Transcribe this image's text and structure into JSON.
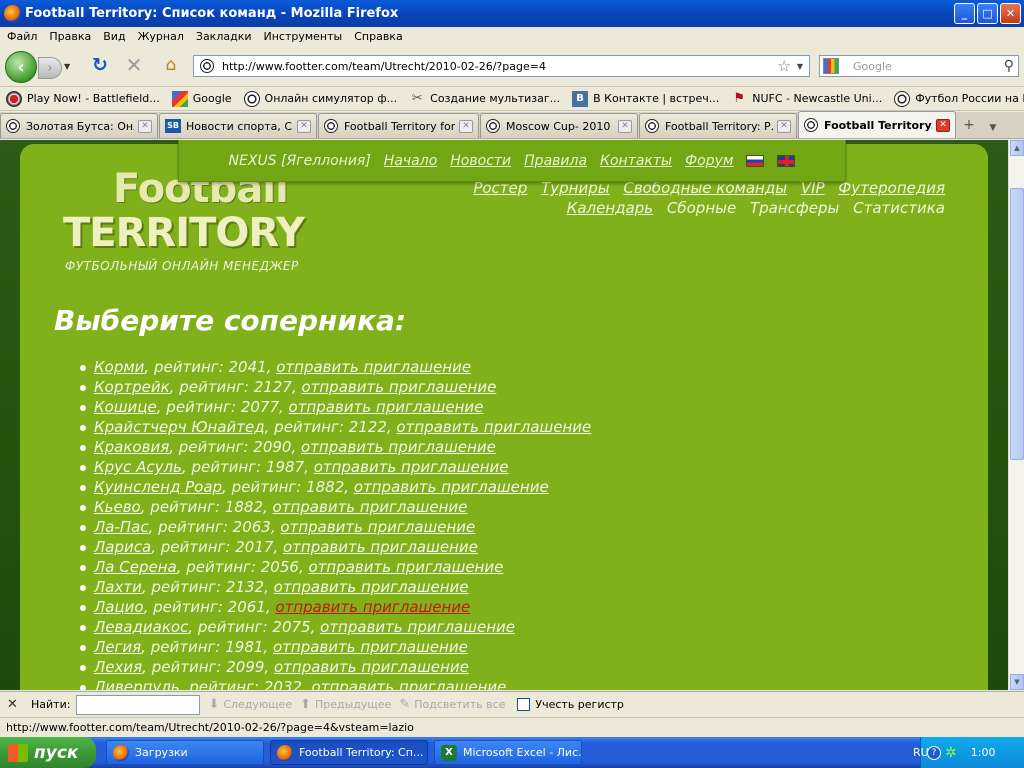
{
  "window": {
    "title": "Football Territory: Список команд - Mozilla Firefox",
    "min": "_",
    "max": "□",
    "close": "✕"
  },
  "menu": [
    "Файл",
    "Правка",
    "Вид",
    "Журнал",
    "Закладки",
    "Инструменты",
    "Справка"
  ],
  "nav": {
    "back_glyph": "‹",
    "forward_glyph": "›",
    "reload_glyph": "↻",
    "stop_glyph": "✕",
    "home_glyph": "⌂",
    "url": "http://www.footter.com/team/Utrecht/2010-02-26/?page=4",
    "search_placeholder": "Google"
  },
  "bookmarks": [
    {
      "label": "Play Now! - Battlefield...",
      "icon": "play-icon"
    },
    {
      "label": "Google",
      "icon": "google-icon"
    },
    {
      "label": "Онлайн симулятор ф...",
      "icon": "ball-icon"
    },
    {
      "label": "Создание мультизаг...",
      "icon": "tools-icon"
    },
    {
      "label": "В Контакте | встреч...",
      "icon": "vk-icon"
    },
    {
      "label": "NUFC - Newcastle Uni...",
      "icon": "nufc-icon"
    },
    {
      "label": "Футбол России на Ев...",
      "icon": "ball-icon"
    }
  ],
  "tabs": [
    {
      "label": "Золотая Бутса: Онл...",
      "active": false
    },
    {
      "label": "Новости спорта, Сп...",
      "active": false
    },
    {
      "label": "Football Territory for...",
      "active": false
    },
    {
      "label": "Moscow Cup- 2010",
      "active": false
    },
    {
      "label": "Football Territory: Р...",
      "active": false
    },
    {
      "label": "Football Territory...",
      "active": true
    }
  ],
  "site": {
    "nav": [
      "NEXUS [Ягеллония]",
      "Начало",
      "Новости",
      "Правила",
      "Контакты",
      "Форум"
    ],
    "logo": {
      "line1": "Football",
      "line2": "TERRITORY",
      "tagline": "ФУТБОЛЬНЫЙ ОНЛАЙН МЕНЕДЖЕР"
    },
    "topnav_row1": [
      "Ростер",
      "Турниры",
      "Свободные команды",
      "VIP",
      "Футеропедия"
    ],
    "topnav_row2": [
      "Календарь",
      "Сборные",
      "Трансферы",
      "Статистика"
    ],
    "heading": "Выберите соперника:",
    "invite_label": "отправить приглашение",
    "rating_label": "рейтинг:",
    "teams": [
      {
        "name": "Корми",
        "rating": "2041"
      },
      {
        "name": "Кортрейк",
        "rating": "2127"
      },
      {
        "name": "Кошице",
        "rating": "2077"
      },
      {
        "name": "Крайстчерч Юнайтед",
        "rating": "2122"
      },
      {
        "name": "Краковия",
        "rating": "2090"
      },
      {
        "name": "Крус Асуль",
        "rating": "1987"
      },
      {
        "name": "Куинсленд Роар",
        "rating": "1882"
      },
      {
        "name": "Кьево",
        "rating": "1882"
      },
      {
        "name": "Ла-Пас",
        "rating": "2063"
      },
      {
        "name": "Лариса",
        "rating": "2017"
      },
      {
        "name": "Ла Серена",
        "rating": "2056"
      },
      {
        "name": "Лахти",
        "rating": "2132"
      },
      {
        "name": "Лацио",
        "rating": "2061",
        "hover": true
      },
      {
        "name": "Левадиакос",
        "rating": "2075"
      },
      {
        "name": "Легия",
        "rating": "1981"
      },
      {
        "name": "Лехия",
        "rating": "2099"
      },
      {
        "name": "Ливерпуль",
        "rating": "2032"
      }
    ]
  },
  "findbar": {
    "close": "✕",
    "label": "Найти:",
    "next": "Следующее",
    "prev": "Предыдущее",
    "highlight": "Подсветить все",
    "match_case": "Учесть регистр"
  },
  "status": "http://www.footter.com/team/Utrecht/2010-02-26/?page=4&vsteam=lazio",
  "taskbar": {
    "start": "пуск",
    "items": [
      "Загрузки",
      "Football Territory: Сп...",
      "Microsoft Excel - Лис..."
    ],
    "lang": "RU",
    "clock": "1:00"
  }
}
